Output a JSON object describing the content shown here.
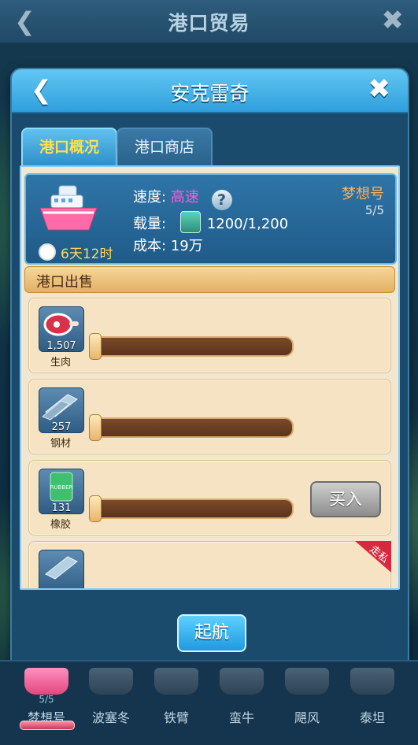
{
  "top_bar": {
    "title": "港口贸易",
    "back_icon": "chevron-left-icon",
    "close_icon": "close-icon"
  },
  "dialog": {
    "title": "安克雷奇",
    "tabs": [
      {
        "label": "港口概况",
        "active": true
      },
      {
        "label": "港口商店",
        "active": false
      }
    ],
    "ship": {
      "speed_label": "速度:",
      "speed_value": "高速",
      "cargo_label": "载量:",
      "cargo_value": "1200/1,200",
      "cost_label": "成本:",
      "cost_value": "19万",
      "timer": "6天12时",
      "name": "梦想号",
      "count": "5/5"
    },
    "section_title": "港口出售",
    "goods": [
      {
        "name": "生肉",
        "count": "1,507",
        "icon": "meat-icon"
      },
      {
        "name": "钢材",
        "count": "257",
        "icon": "steel-icon"
      },
      {
        "name": "橡胶",
        "count": "131",
        "icon": "rubber-barrel-icon",
        "buy_label": "买入",
        "icon_text": "RUBBER"
      },
      {
        "icon": "steel-icon",
        "badge": "走私"
      }
    ],
    "sail_button": "起航"
  },
  "bottom_ships": [
    {
      "name": "梦想号",
      "count": "5/5",
      "selected": true
    },
    {
      "name": "波塞冬"
    },
    {
      "name": "铁臂"
    },
    {
      "name": "蛮牛"
    },
    {
      "name": "飓风"
    },
    {
      "name": "泰坦"
    }
  ],
  "colors": {
    "accent": "#2f9fdc",
    "speed": "#ff5ad9",
    "gold": "#ffd95a"
  }
}
